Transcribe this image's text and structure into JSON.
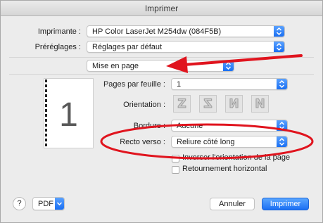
{
  "window": {
    "title": "Imprimer"
  },
  "printer": {
    "label": "Imprimante :",
    "value": "HP Color LaserJet M254dw (084F5B)"
  },
  "presets": {
    "label": "Préréglages :",
    "value": "Réglages par défaut"
  },
  "section": {
    "value": "Mise en page"
  },
  "preview": {
    "page_number": "1"
  },
  "layout": {
    "pages_per_sheet": {
      "label": "Pages par feuille :",
      "value": "1"
    },
    "orientation": {
      "label": "Orientation :",
      "options": [
        "Z",
        "Z",
        "N",
        "N"
      ]
    },
    "border": {
      "label": "Bordure :",
      "value": "Aucune"
    },
    "duplex": {
      "label": "Recto verso :",
      "value": "Reliure côté long"
    },
    "reverse_orientation": {
      "label": "Inverser l'orientation de la page"
    },
    "flip_horizontal": {
      "label": "Retournement horizontal"
    }
  },
  "footer": {
    "help": "?",
    "pdf": "PDF",
    "cancel": "Annuler",
    "print": "Imprimer"
  },
  "annotations": {
    "color": "#e0141e"
  }
}
